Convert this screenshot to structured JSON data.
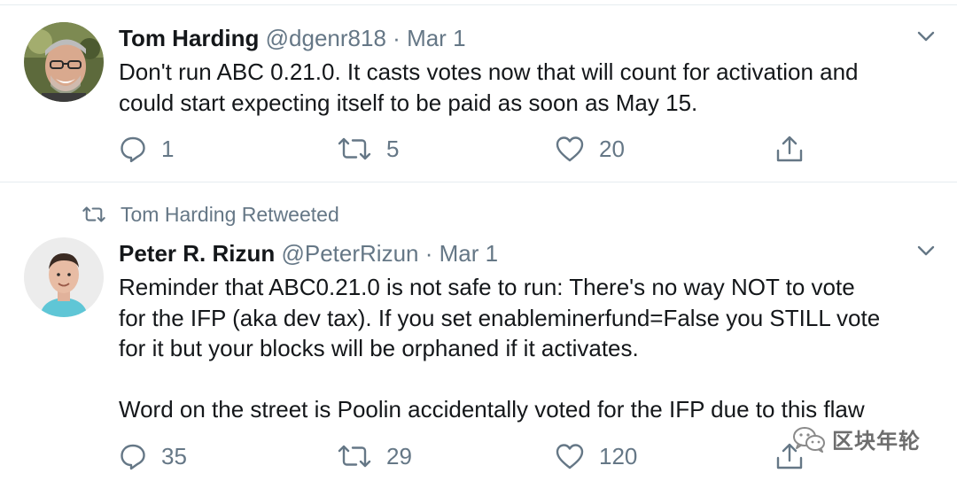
{
  "tweets": [
    {
      "name": "Tom Harding",
      "handle": "@dgenr818",
      "separator": "·",
      "date": "Mar 1",
      "text_lines": [
        "Don't run ABC 0.21.0. It casts votes now that will count for activation and",
        "could start expecting itself to be paid as soon as May 15."
      ],
      "replies": "1",
      "retweets": "5",
      "likes": "20"
    },
    {
      "retweeted_by": "Tom Harding Retweeted",
      "name": "Peter R. Rizun",
      "handle": "@PeterRizun",
      "separator": "·",
      "date": "Mar 1",
      "text_lines": [
        "Reminder that ABC0.21.0 is not safe to run: There's no way NOT to vote",
        "for the IFP (aka dev tax). If you set enableminerfund=False you STILL vote",
        "for it but your blocks will be orphaned if it activates."
      ],
      "text_lines_2": [
        "Word on the street is Poolin accidentally voted for the IFP due to this flaw"
      ],
      "replies": "35",
      "retweets": "29",
      "likes": "120"
    }
  ],
  "watermark": {
    "text": "区块年轮",
    "icon": "wechat-icon"
  },
  "colors": {
    "text": "#14171a",
    "muted": "#657786",
    "divider": "#e6ecf0"
  }
}
